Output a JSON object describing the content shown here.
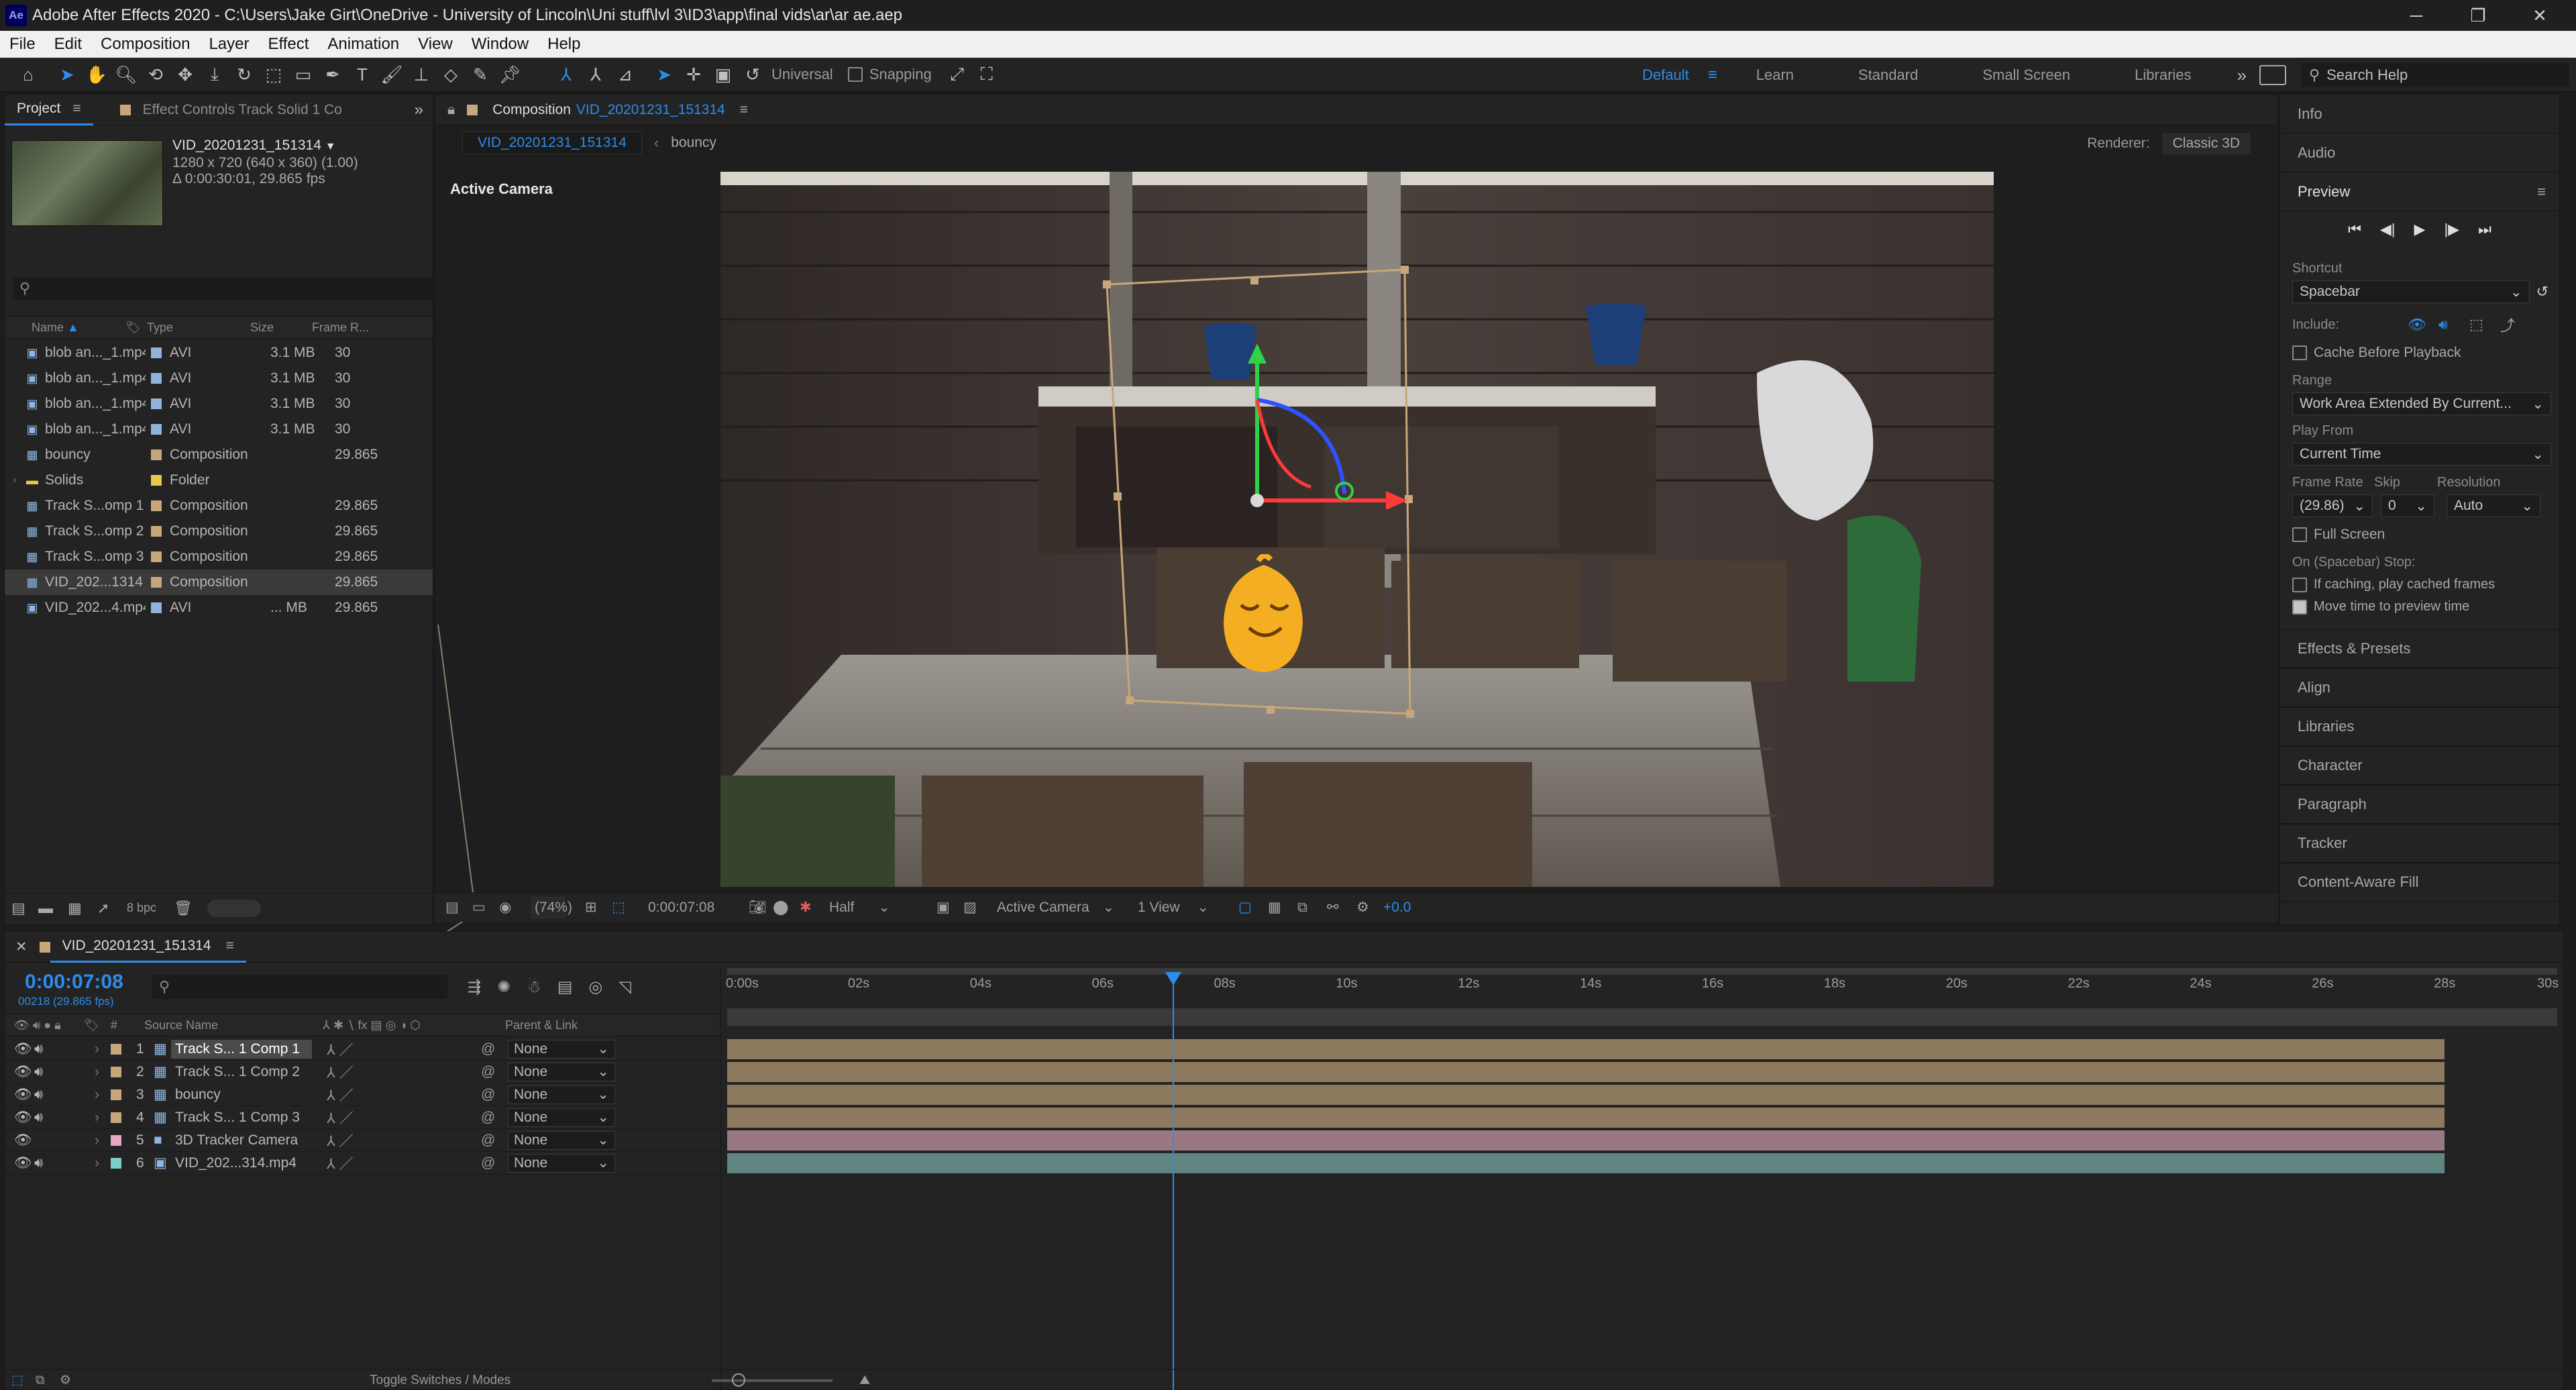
{
  "titlebar": {
    "app_icon": "Ae",
    "title": "Adobe After Effects 2020 - C:\\Users\\Jake Girt\\OneDrive - University of Lincoln\\Uni stuff\\lvl 3\\ID3\\app\\final vids\\ar\\ar ae.aep",
    "minimize": "─",
    "maximize": "❐",
    "close": "✕"
  },
  "menu": [
    "File",
    "Edit",
    "Composition",
    "Layer",
    "Effect",
    "Animation",
    "View",
    "Window",
    "Help"
  ],
  "toolbar": {
    "universal": "Universal",
    "snapping": "Snapping",
    "workspaces": [
      "Default",
      "Learn",
      "Standard",
      "Small Screen",
      "Libraries"
    ],
    "active_workspace": "Default",
    "overflow": "»",
    "search_placeholder": "Search Help"
  },
  "project": {
    "tab": "Project",
    "effect_tab": "Effect Controls Track Solid 1 Co",
    "selected_name": "VID_20201231_151314",
    "info_line1": "1280 x 720  (640 x 360) (1.00)",
    "info_line2": "Δ 0:00:30:01, 29.865 fps",
    "columns": [
      "Name",
      "Type",
      "Size",
      "Frame R..."
    ],
    "items": [
      {
        "name": "blob an..._1.mp4",
        "type": "AVI",
        "size": "3.1 MB",
        "rate": "30",
        "color": "#8fb3d9",
        "icon": "file-icon"
      },
      {
        "name": "blob an..._1.mp4",
        "type": "AVI",
        "size": "3.1 MB",
        "rate": "30",
        "color": "#8fb3d9",
        "icon": "file-icon"
      },
      {
        "name": "blob an..._1.mp4",
        "type": "AVI",
        "size": "3.1 MB",
        "rate": "30",
        "color": "#8fb3d9",
        "icon": "file-icon"
      },
      {
        "name": "blob an..._1.mp4",
        "type": "AVI",
        "size": "3.1 MB",
        "rate": "30",
        "color": "#8fb3d9",
        "icon": "file-icon"
      },
      {
        "name": "bouncy",
        "type": "Composition",
        "size": "",
        "rate": "29.865",
        "color": "#c7a77a",
        "icon": "composition-icon"
      },
      {
        "name": "Solids",
        "type": "Folder",
        "size": "",
        "rate": "",
        "color": "#e6c94a",
        "icon": "folder-icon"
      },
      {
        "name": "Track S...omp 1",
        "type": "Composition",
        "size": "",
        "rate": "29.865",
        "color": "#c7a77a",
        "icon": "composition-icon"
      },
      {
        "name": "Track S...omp 2",
        "type": "Composition",
        "size": "",
        "rate": "29.865",
        "color": "#c7a77a",
        "icon": "composition-icon"
      },
      {
        "name": "Track S...omp 3",
        "type": "Composition",
        "size": "",
        "rate": "29.865",
        "color": "#c7a77a",
        "icon": "composition-icon"
      },
      {
        "name": "VID_202...1314",
        "type": "Composition",
        "size": "",
        "rate": "29.865",
        "color": "#c7a77a",
        "icon": "composition-icon"
      },
      {
        "name": "VID_202...4.mp4",
        "type": "AVI",
        "size": "... MB",
        "rate": "29.865",
        "color": "#8fb3d9",
        "icon": "file-icon"
      }
    ],
    "bpc": "8 bpc"
  },
  "composition": {
    "tab_prefix": "Composition",
    "tab_name": "VID_20201231_151314",
    "crumb_active": "VID_20201231_151314",
    "crumb_other": "bouncy",
    "renderer_label": "Renderer:",
    "renderer_value": "Classic 3D",
    "view_label": "Active Camera",
    "footer": {
      "zoom": "(74%)",
      "timecode": "0:00:07:08",
      "resolution": "Half",
      "camera": "Active Camera",
      "views": "1 View",
      "exposure": "+0.0"
    }
  },
  "right_panel": {
    "info": "Info",
    "audio": "Audio",
    "preview": "Preview",
    "shortcut_label": "Shortcut",
    "shortcut_value": "Spacebar",
    "include_label": "Include:",
    "cache_before": "Cache Before Playback",
    "range_label": "Range",
    "range_value": "Work Area Extended By Current...",
    "play_from_label": "Play From",
    "play_from_value": "Current Time",
    "frame_rate_label": "Frame Rate",
    "skip_label": "Skip",
    "resolution_label": "Resolution",
    "frame_rate_value": "(29.86)",
    "skip_value": "0",
    "resolution_value": "Auto",
    "full_screen": "Full Screen",
    "on_stop_label": "On (Spacebar) Stop:",
    "if_caching": "If caching, play cached frames",
    "move_time": "Move time to preview time",
    "collapsed": [
      "Effects & Presets",
      "Align",
      "Libraries",
      "Character",
      "Paragraph",
      "Tracker",
      "Content-Aware Fill"
    ]
  },
  "timeline": {
    "tab": "VID_20201231_151314",
    "timecode": "0:00:07:08",
    "frame_info": "00218 (29.865 fps)",
    "col_source": "Source Name",
    "col_parent": "Parent & Link",
    "ruler": [
      "0:00s",
      "02s",
      "04s",
      "06s",
      "08s",
      "10s",
      "12s",
      "14s",
      "16s",
      "18s",
      "20s",
      "22s",
      "24s",
      "26s",
      "28s",
      "30s"
    ],
    "playhead_seconds": 7.3,
    "duration_seconds": 30,
    "toggle_label": "Toggle Switches / Modes",
    "layers": [
      {
        "num": "1",
        "name": "Track S... 1 Comp 1",
        "parent": "None",
        "color": "#c7a77a",
        "bar": "#8d7a5e",
        "selected": true,
        "icon": "composition-icon"
      },
      {
        "num": "2",
        "name": "Track S... 1 Comp 2",
        "parent": "None",
        "color": "#c7a77a",
        "bar": "#8d7a5e",
        "selected": false,
        "icon": "composition-icon"
      },
      {
        "num": "3",
        "name": "bouncy",
        "parent": "None",
        "color": "#c7a77a",
        "bar": "#8d7a5e",
        "selected": false,
        "icon": "composition-icon"
      },
      {
        "num": "4",
        "name": "Track S... 1 Comp 3",
        "parent": "None",
        "color": "#c7a77a",
        "bar": "#8d7a5e",
        "selected": false,
        "icon": "composition-icon"
      },
      {
        "num": "5",
        "name": "3D Tracker Camera",
        "parent": "None",
        "color": "#e8a6c5",
        "bar": "#9a7882",
        "selected": false,
        "icon": "camera-icon"
      },
      {
        "num": "6",
        "name": "VID_202...314.mp4",
        "parent": "None",
        "color": "#7ccfc7",
        "bar": "#5f8580",
        "selected": false,
        "icon": "file-icon"
      }
    ]
  }
}
